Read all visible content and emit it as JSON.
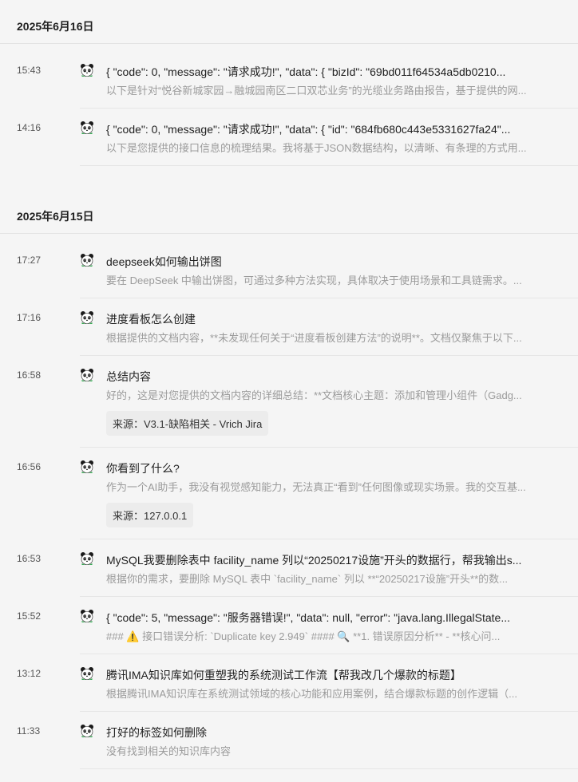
{
  "groups": [
    {
      "date": "2025年6月16日",
      "items": [
        {
          "time": "15:43",
          "title": "{ \"code\": 0, \"message\": \"请求成功!\", \"data\": { \"bizId\": \"69bd011f64534a5db0210...",
          "summary": "以下是针对“悦谷新城家园→融城园南区二口双芯业务”的光缆业务路由报告，基于提供的网..."
        },
        {
          "time": "14:16",
          "title": "{ \"code\": 0, \"message\": \"请求成功!\", \"data\": { \"id\": \"684fb680c443e5331627fa24\"...",
          "summary": "以下是您提供的接口信息的梳理结果。我将基于JSON数据结构，以清晰、有条理的方式用..."
        }
      ]
    },
    {
      "date": "2025年6月15日",
      "items": [
        {
          "time": "17:27",
          "title": "deepseek如何输出饼图",
          "summary": "要在 DeepSeek 中输出饼图，可通过多种方法实现，具体取决于使用场景和工具链需求。..."
        },
        {
          "time": "17:16",
          "title": "进度看板怎么创建",
          "summary": "根据提供的文档内容，**未发现任何关于“进度看板创建方法”的说明**。文档仅聚焦于以下..."
        },
        {
          "time": "16:58",
          "title": "总结内容",
          "summary": "好的，这是对您提供的文档内容的详细总结：**文档核心主题：添加和管理小组件（Gadg...",
          "source": "来源：V3.1-缺陷相关 - Vrich Jira"
        },
        {
          "time": "16:56",
          "title": "你看到了什么?",
          "summary": "作为一个AI助手，我没有视觉感知能力，无法真正“看到”任何图像或现实场景。我的交互基...",
          "source": "来源：127.0.0.1"
        },
        {
          "time": "16:53",
          "title": "MySQL我要删除表中 facility_name 列以“20250217设施”开头的数据行，帮我输出s...",
          "summary": "根据你的需求，要删除 MySQL 表中 `facility_name` 列以 **“20250217设施”开头**的数..."
        },
        {
          "time": "15:52",
          "title": "{ \"code\": 5, \"message\": \"服务器错误!\", \"data\": null, \"error\": \"java.lang.IllegalState...",
          "summary": "### ⚠️ 接口错误分析: `Duplicate key 2.949` #### 🔍 **1. 错误原因分析** - **核心问..."
        },
        {
          "time": "13:12",
          "title": "腾讯IMA知识库如何重塑我的系统测试工作流【帮我改几个爆款的标题】",
          "summary": "根据腾讯IMA知识库在系统测试领域的核心功能和应用案例，结合爆款标题的创作逻辑（..."
        },
        {
          "time": "11:33",
          "title": "打好的标签如何删除",
          "summary": "没有找到相关的知识库内容"
        }
      ]
    }
  ],
  "icon": "panda-avatar-icon"
}
